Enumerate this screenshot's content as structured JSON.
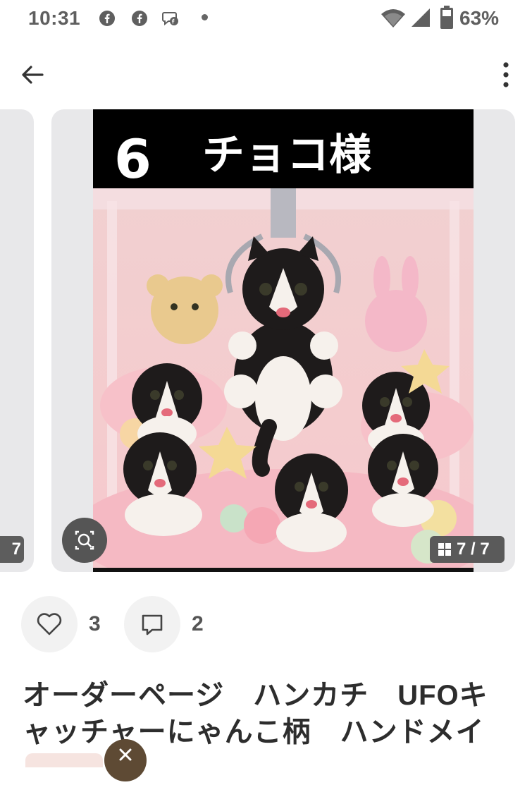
{
  "status_bar": {
    "time": "10:31",
    "battery_percent": "63%",
    "notification_icons": [
      "facebook-icon",
      "facebook-icon",
      "messenger-icon"
    ]
  },
  "toolbar": {
    "back_icon": "arrow-left-icon",
    "menu_icon": "more-vertical-icon"
  },
  "gallery": {
    "image_caption_number": "6",
    "image_caption_text": "チョコ様",
    "prev_counter": "7",
    "counter": "7 / 7",
    "current_index": 7,
    "total": 7
  },
  "actions": {
    "likes": "3",
    "comments": "2"
  },
  "product": {
    "title": "オーダーページ　ハンカチ　UFOキャッチャーにゃんこ柄　ハンドメイ"
  },
  "colors": {
    "card_bg": "#e8e8ea",
    "badge_bg": "#5a5a5a",
    "text_primary": "#2d2d2d"
  }
}
